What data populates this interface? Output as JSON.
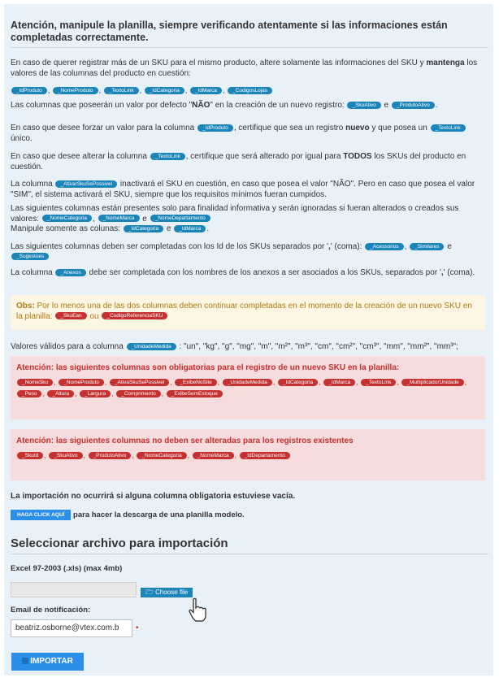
{
  "title": "Atención, manipule la planilla, siempre verificando atentamente si las informaciones están completadas correctamente.",
  "p1": {
    "a": "En caso de querer registrar más de un SKU para el mismo producto, altere solamente las informaciones del SKU y ",
    "b": "mantenga",
    "c": " los valores de las columnas del producto en cuestión:"
  },
  "tags_p1": [
    "_IdProduto",
    "_NomeProduto",
    "_TextoLink",
    "_IdCategoria",
    "_IdMarca",
    "_CodigosLojas"
  ],
  "p2": {
    "a": "Las columnas que poseerán un valor por defecto \"",
    "b": "NÃO",
    "c": "\" en la creación de un nuevo registro: ",
    "tag1": "_SkuAtivo",
    "e": " e ",
    "tag2": "_ProdutoAtivo",
    "end": "."
  },
  "p3": {
    "a": "En caso que desee forzar un valor para la columna ",
    "tag": "_IdProduto",
    "b": ", certifique que sea un registro ",
    "c": "nuevo",
    "d": " y que posea un ",
    "tag2": "_TextoLink",
    "e": " único."
  },
  "p4": {
    "a": "En caso que desee alterar la columna ",
    "tag": "_TextoLink",
    "b": ", certifique que será alterado por igual para ",
    "c": "TODOS",
    "d": " los SKUs del producto en cuestión."
  },
  "p5": {
    "a": "La columna ",
    "tag": "_AtivarSkuSePossivel",
    "b": " inactivará el SKU en cuestión, en caso que posea el valor \"NÃO\". Pero en caso que posea el valor \"SIM\", el sistema activará el SKU, siempre que los requisitos mínimos fueran cumpidos."
  },
  "p6": {
    "a": "Las siguientes columnas están presentes solo para finalidad informativa y serán ignoradas si fueran alterados o creados sus valores: ",
    "tag1": "_NomeCategoria",
    "s1": ", ",
    "tag2": "_NomeMarca",
    "s2": " e ",
    "tag3": "_NomeDepartamento",
    "b": "Manipule somente as colunas: ",
    "tag4": "_IdCategoria",
    "s3": " e ",
    "tag5": "_IdMarca",
    "end": "."
  },
  "p7": {
    "a": "Las siguientes columnas deben ser completadas con los Id de los SKUs separados por '",
    "b": ",",
    "c": "' (coma): ",
    "tag1": "_Acessorios",
    "s1": ", ",
    "tag2": "_Similares",
    "s2": " e ",
    "tag3": "_Sugestoes"
  },
  "p8": {
    "a": "La columna ",
    "tag": "_Anexos",
    "b": " debe ser completada con los nombres de los anexos a ser asociados a los SKUs, separados por '",
    "c": ",",
    "d": "' (coma)."
  },
  "obs": {
    "label": "Obs:",
    "text": " Por lo menos una de las dos columnas deben continuar completadas en el momento de la creación de un nuevo SKU en la planilla: ",
    "tag1": "_SkuEan",
    "s": " ou ",
    "tag2": "_CodigoReferenciaSKU"
  },
  "p9": {
    "a": "Valores válidos para a columna ",
    "tag": "_UnidadeMedida",
    "b": " : \"un\", \"kg\", \"g\", \"mg\", \"m\", \"m²\", \"m³\", \"cm\", \"cm²\", \"cm³\", \"mm\", \"mm²\", \"mm³\";"
  },
  "alert1": {
    "head": "Atención: las siguientes columnas son obligatorias para el registro de un nuevo SKU en la planilla:",
    "tags": [
      "_NomeSku",
      "_NomeProduto",
      "_AtivaSkuSePossivel",
      "_ExibeNoSite",
      "_UnidadeMedida",
      "_IdCategoria",
      "_IdMarca",
      "_TextoLink",
      "_MultiplicadorUnidade",
      "_Peso",
      "_Altura",
      "_Largura",
      "_Comprimento",
      "_ExibeSemEstoque"
    ]
  },
  "alert2": {
    "head": "Atención: las siguientes columnas no deben ser alteradas para los registros existentes",
    "tags": [
      "_SkuId",
      "_SkuAtivo",
      "_ProdutoAtivo",
      "_NomeCategoria",
      "_NomeMarca",
      "_IdDepartamento"
    ]
  },
  "import_note": "La importación no ocurrirá si alguna columna obligatoria estuviese vacía.",
  "click_btn": "HAGA CLICK AQUÍ",
  "click_text": " para hacer la descarga de una planilla modelo.",
  "section_title": "Seleccionar archivo para importación",
  "file_label": "Excel 97-2003 (.xls) (max 4mb)",
  "choose_file": "Choose file",
  "email_label": "Email de notificación:",
  "email_value": "beatriz.osborne@vtex.com.b",
  "required_mark": "•",
  "import_btn": "IMPORTAR",
  "colors": {
    "tag": "#1b84b9",
    "tag_red": "#c53030",
    "panel": "#e9f1f8",
    "button": "#2b8ee8"
  }
}
